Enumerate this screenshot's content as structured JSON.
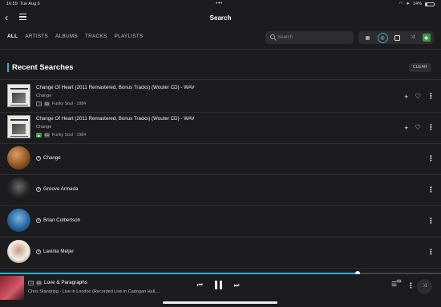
{
  "status": {
    "time": "16:59",
    "date": "Tue Aug 6",
    "battery": "14%"
  },
  "header": {
    "title": "Search"
  },
  "tabs": [
    "ALL",
    "ARTISTS",
    "ALBUMS",
    "TRACKS",
    "PLAYLISTS"
  ],
  "search": {
    "placeholder": "Search",
    "value": ""
  },
  "filter_icons": [
    "calendar-icon",
    "search-history-icon",
    "album-grid-icon",
    "shuffle-icon",
    "green-app-icon"
  ],
  "section": {
    "title": "Recent Searches",
    "clear_label": "CLEAR"
  },
  "tracks": [
    {
      "title": "Change Of Heart (2011 Remastered, Bonus Tracks) (Wouter CD) - WAV",
      "artist": "Change",
      "meta": "Funky Soul · 1984"
    },
    {
      "title": "Change Of Heart (2011 Remastered, Bonus Tracks) (Wouter CD) - WAV",
      "artist": "Change",
      "meta": "Funky Soul · 1984"
    }
  ],
  "artists": [
    {
      "name": "Change",
      "colors": [
        "#a0612c",
        "#3b1f10"
      ]
    },
    {
      "name": "Groove Armada",
      "colors": [
        "#2a2a2a",
        "#0a0a0a"
      ]
    },
    {
      "name": "Brian Culbertson",
      "colors": [
        "#2e6fa8",
        "#0f2a45"
      ]
    },
    {
      "name": "Lavinia Meijer",
      "colors": [
        "#f2efe9",
        "#6a4a3a"
      ]
    }
  ],
  "player": {
    "title": "Love & Paragraphs",
    "subtitle": "Chris Standring · Live in London (Recorded Live in Cadogan Hall,...",
    "progress": 0.81,
    "queue_count": "24"
  },
  "colors": {
    "accent": "#29b0d1",
    "background": "#1c1c1e",
    "green": "#3a9a4a"
  }
}
